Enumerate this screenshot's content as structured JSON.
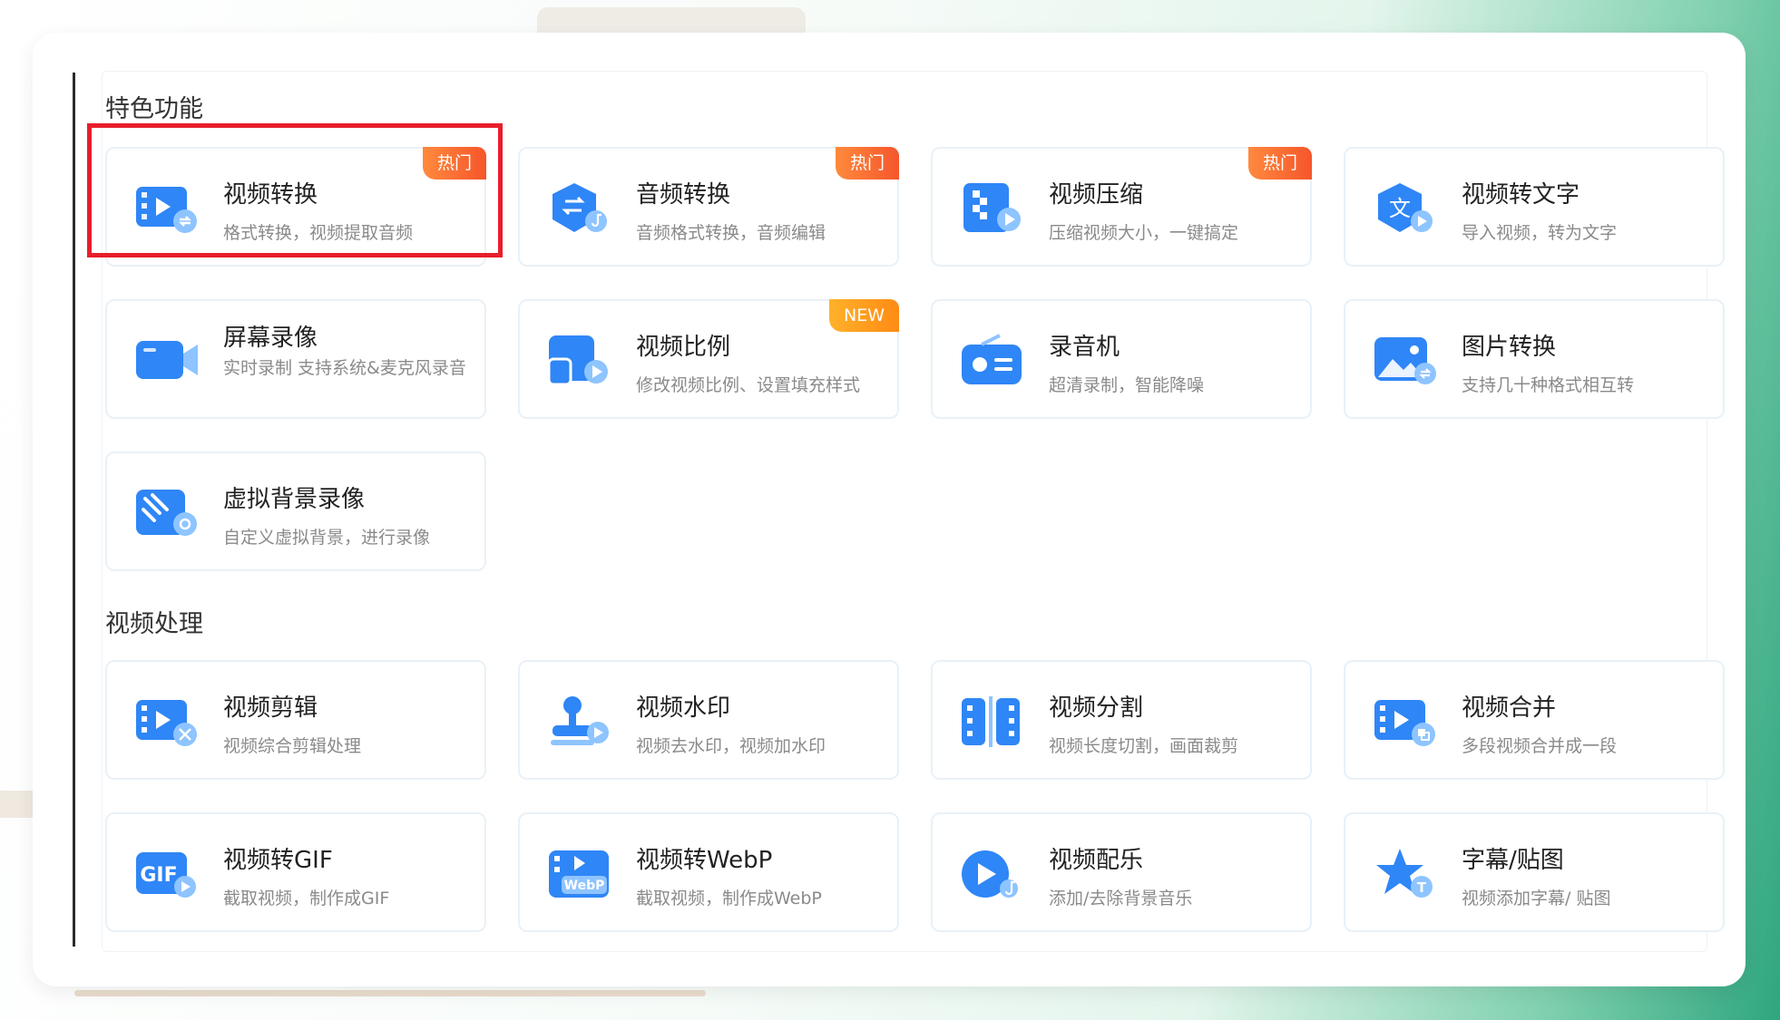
{
  "sections": [
    {
      "title": "特色功能"
    },
    {
      "title": "视频处理"
    }
  ],
  "cards": [
    {
      "id": "video-convert",
      "title": "视频转换",
      "desc": "格式转换，视频提取音频",
      "badge": "热门",
      "icon": "video-convert-icon"
    },
    {
      "id": "audio-convert",
      "title": "音频转换",
      "desc": "音频格式转换，音频编辑",
      "badge": "热门",
      "icon": "audio-convert-icon"
    },
    {
      "id": "video-compress",
      "title": "视频压缩",
      "desc": "压缩视频大小，一键搞定",
      "badge": "热门",
      "icon": "video-compress-icon"
    },
    {
      "id": "video-to-text",
      "title": "视频转文字",
      "desc": "导入视频，转为文字",
      "badge": "",
      "icon": "video-to-text-icon"
    },
    {
      "id": "screen-record",
      "title": "屏幕录像",
      "desc": "实时录制 支持系统&麦克风录音",
      "badge": "",
      "icon": "screen-record-icon"
    },
    {
      "id": "video-ratio",
      "title": "视频比例",
      "desc": "修改视频比例、设置填充样式",
      "badge": "NEW",
      "icon": "video-ratio-icon"
    },
    {
      "id": "recorder",
      "title": "录音机",
      "desc": "超清录制，智能降噪",
      "badge": "",
      "icon": "recorder-icon"
    },
    {
      "id": "image-convert",
      "title": "图片转换",
      "desc": "支持几十种格式相互转",
      "badge": "",
      "icon": "image-convert-icon"
    },
    {
      "id": "virtual-bg-record",
      "title": "虚拟背景录像",
      "desc": "自定义虚拟背景，进行录像",
      "badge": "",
      "icon": "virtual-background-icon"
    },
    {
      "id": "video-edit",
      "title": "视频剪辑",
      "desc": "视频综合剪辑处理",
      "badge": "",
      "icon": "video-edit-icon"
    },
    {
      "id": "video-watermark",
      "title": "视频水印",
      "desc": "视频去水印，视频加水印",
      "badge": "",
      "icon": "watermark-stamp-icon"
    },
    {
      "id": "video-split",
      "title": "视频分割",
      "desc": "视频长度切割，画面裁剪",
      "badge": "",
      "icon": "video-split-icon"
    },
    {
      "id": "video-merge",
      "title": "视频合并",
      "desc": "多段视频合并成一段",
      "badge": "",
      "icon": "video-merge-icon"
    },
    {
      "id": "video-to-gif",
      "title": "视频转GIF",
      "desc": "截取视频，制作成GIF",
      "badge": "",
      "icon": "gif-icon"
    },
    {
      "id": "video-to-webp",
      "title": "视频转WebP",
      "desc": "截取视频，制作成WebP",
      "badge": "",
      "icon": "webp-icon"
    },
    {
      "id": "video-music",
      "title": "视频配乐",
      "desc": "添加/去除背景音乐",
      "badge": "",
      "icon": "video-music-icon"
    },
    {
      "id": "subtitle-sticker",
      "title": "字幕/贴图",
      "desc": "视频添加字幕/ 贴图",
      "badge": "",
      "icon": "subtitle-sticker-icon"
    }
  ],
  "icon_text": {
    "gif": "GIF",
    "webp": "WebP",
    "text": "文",
    "subtitle": "T"
  },
  "colors": {
    "icon_blue": "#2f86f6",
    "icon_light": "#8ec4ff",
    "hot_badge": "#f5562b",
    "new_badge": "#ff8b14",
    "highlight": "#e81e2b"
  }
}
